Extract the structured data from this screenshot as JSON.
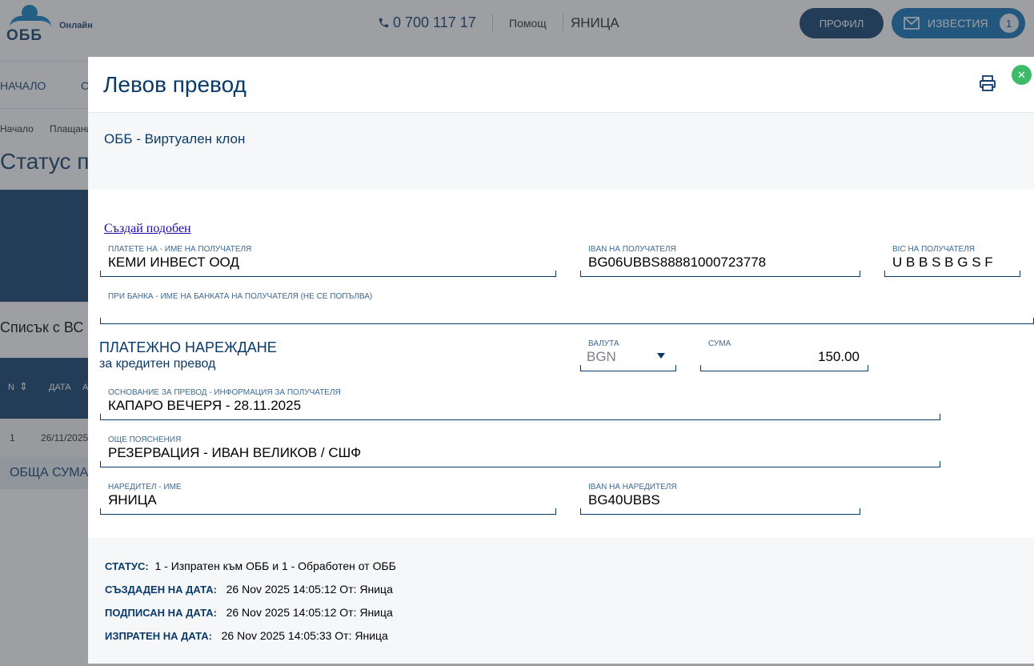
{
  "header": {
    "logo_text": "ОББ",
    "logo_sub": "Онлайн",
    "phone": "0 700 117 17",
    "help": "Помощ",
    "user": "ЯНИЦА",
    "profile_label": "ПРОФИЛ",
    "notifications_label": "ИЗВЕСТИЯ",
    "notifications_count": "1"
  },
  "background": {
    "nav": [
      "НАЧАЛО",
      "С"
    ],
    "breadcrumb": [
      "Начало",
      "Плащани"
    ],
    "title": "Статус п",
    "list_title": "Списък с  ВС",
    "table_headers": [
      "N",
      "ДАТА",
      "А"
    ],
    "row": [
      "1",
      "26/11/2025"
    ],
    "total": "ОБЩА СУМА"
  },
  "modal": {
    "title": "Левов превод",
    "branch": "ОББ - Виртуален клон",
    "create_similar": "Създай подобен",
    "fields": {
      "beneficiary_name": {
        "label": "ПЛАТЕТЕ НА - ИМЕ НА ПОЛУЧАТЕЛЯ",
        "value": "КЕМИ ИНВЕСТ ООД"
      },
      "beneficiary_iban": {
        "label": "IBAN НА ПОЛУЧАТЕЛЯ",
        "value": "BG06UBBS88881000723778"
      },
      "beneficiary_bic": {
        "label": "BIC НА ПОЛУЧАТЕЛЯ",
        "value": "U B B S B G S F"
      },
      "beneficiary_bank": {
        "label": "ПРИ БАНКА - ИМЕ НА БАНКАТА НА ПОЛУЧАТЕЛЯ (НЕ СЕ ПОПЪЛВА)",
        "value": ""
      },
      "currency": {
        "label": "ВАЛУТА",
        "value": "BGN"
      },
      "amount": {
        "label": "СУМА",
        "value": "150.00"
      },
      "reason": {
        "label": "ОСНОВАНИЕ ЗА ПРЕВОД - ИНФОРМАЦИЯ ЗА ПОЛУЧАТЕЛЯ",
        "value": "КАПАРО ВЕЧЕРЯ - 28.11.2025"
      },
      "details": {
        "label": "ОЩЕ ПОЯСНЕНИЯ",
        "value": "РЕЗЕРВАЦИЯ - ИВАН ВЕЛИКОВ / СШФ"
      },
      "orderer_name": {
        "label": "НАРЕДИТЕЛ - ИМЕ",
        "value": "ЯНИЦА"
      },
      "orderer_iban": {
        "label": "IBAN НА НАРЕДИТЕЛЯ",
        "value": "BG40UBBS"
      }
    },
    "order_title": "ПЛАТЕЖНО НАРЕЖДАНЕ",
    "order_subtitle": "за кредитен превод",
    "status": {
      "status_label": "СТАТУС:",
      "status_value": "1 - Изпратен към ОББ  и   1 - Обработен от ОББ",
      "created_label": "СЪЗДАДЕН НА ДАТА:",
      "created_value": "26 Nov 2025 14:05:12  От: Яница",
      "signed_label": "ПОДПИСАН  НА ДАТА:",
      "signed_value": "26 Nov 2025 14:05:12  От: Яница",
      "sent_label": "ИЗПРАТЕН  НА ДАТА:",
      "sent_value": "26 Nov 2025 14:05:33  От: Яница"
    }
  },
  "colors": {
    "brand_dark": "#0a3a6a",
    "brand_blue": "#0a6fb5",
    "close_green": "#3dbb6a"
  }
}
